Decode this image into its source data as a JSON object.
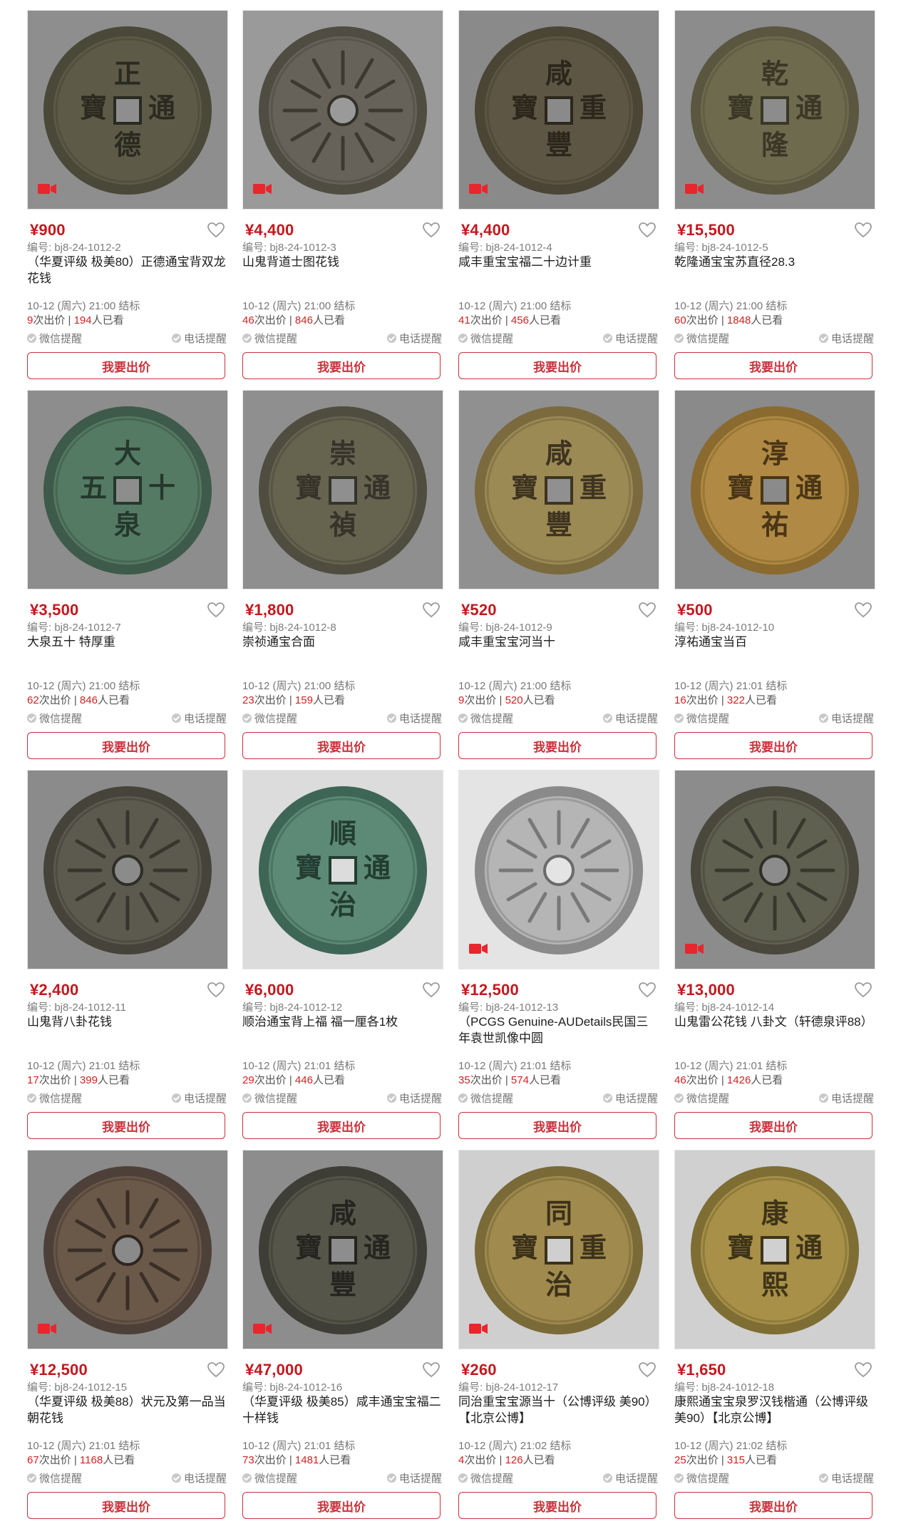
{
  "ui": {
    "code_prefix": "编号: ",
    "wechat_remind": "微信提醒",
    "phone_remind": "电话提醒",
    "bid_label": "我要出价",
    "bids_suffix": "次出价 | ",
    "viewers_suffix": "人已看",
    "currency": "¥",
    "video_icon": "video-camera-icon",
    "favorite_icon": "heart-outline-icon",
    "accent_color": "#c5171f"
  },
  "items": [
    {
      "price": "¥900",
      "code": "bj8-24-1012-2",
      "title": "（华夏评级 极美80）正德通宝背双龙花钱",
      "end": "10-12 (周六) 21:00 结标",
      "bids": "9",
      "views": "194",
      "coin": [
        "正",
        "通",
        "德",
        "寶"
      ],
      "video": true
    },
    {
      "price": "¥4,400",
      "code": "bj8-24-1012-3",
      "title": "山鬼背道士图花钱",
      "end": "10-12 (周六) 21:00 结标",
      "bids": "46",
      "views": "846",
      "coin": [
        "",
        "",
        "",
        ""
      ],
      "video": true
    },
    {
      "price": "¥4,400",
      "code": "bj8-24-1012-4",
      "title": "咸丰重宝宝福二十边计重",
      "end": "10-12 (周六) 21:00 结标",
      "bids": "41",
      "views": "456",
      "coin": [
        "咸",
        "重",
        "豐",
        "寶"
      ],
      "video": true
    },
    {
      "price": "¥15,500",
      "code": "bj8-24-1012-5",
      "title": "乾隆通宝宝苏直径28.3",
      "end": "10-12 (周六) 21:00 结标",
      "bids": "60",
      "views": "1848",
      "coin": [
        "乾",
        "通",
        "隆",
        "寶"
      ],
      "video": true
    },
    {
      "price": "¥3,500",
      "code": "bj8-24-1012-7",
      "title": "大泉五十 特厚重",
      "end": "10-12 (周六) 21:00 结标",
      "bids": "62",
      "views": "846",
      "coin": [
        "大",
        "十",
        "泉",
        "五"
      ],
      "video": false
    },
    {
      "price": "¥1,800",
      "code": "bj8-24-1012-8",
      "title": "崇祯通宝合面",
      "end": "10-12 (周六) 21:00 结标",
      "bids": "23",
      "views": "159",
      "coin": [
        "崇",
        "通",
        "禎",
        "寶"
      ],
      "video": false
    },
    {
      "price": "¥520",
      "code": "bj8-24-1012-9",
      "title": "咸丰重宝宝河当十",
      "end": "10-12 (周六) 21:00 结标",
      "bids": "9",
      "views": "520",
      "coin": [
        "咸",
        "重",
        "豐",
        "寶"
      ],
      "video": false
    },
    {
      "price": "¥500",
      "code": "bj8-24-1012-10",
      "title": "淳祐通宝当百",
      "end": "10-12 (周六) 21:01 结标",
      "bids": "16",
      "views": "322",
      "coin": [
        "淳",
        "通",
        "祐",
        "寶"
      ],
      "video": false
    },
    {
      "price": "¥2,400",
      "code": "bj8-24-1012-11",
      "title": "山鬼背八卦花钱",
      "end": "10-12 (周六) 21:01 结标",
      "bids": "17",
      "views": "399",
      "coin": [
        "",
        "",
        "",
        ""
      ],
      "video": false
    },
    {
      "price": "¥6,000",
      "code": "bj8-24-1012-12",
      "title": "顺治通宝背上福 福一厘各1枚",
      "end": "10-12 (周六) 21:01 结标",
      "bids": "29",
      "views": "446",
      "coin": [
        "順",
        "通",
        "治",
        "寶"
      ],
      "video": false
    },
    {
      "price": "¥12,500",
      "code": "bj8-24-1012-13",
      "title": "（PCGS Genuine-AUDetails民国三年袁世凯像中圆",
      "end": "10-12 (周六) 21:01 结标",
      "bids": "35",
      "views": "574",
      "coin": [
        "",
        "",
        "",
        ""
      ],
      "video": true
    },
    {
      "price": "¥13,000",
      "code": "bj8-24-1012-14",
      "title": "山鬼雷公花钱 八卦文（轩德泉评88）",
      "end": "10-12 (周六) 21:01 结标",
      "bids": "46",
      "views": "1426",
      "coin": [
        "",
        "",
        "",
        ""
      ],
      "video": true
    },
    {
      "price": "¥12,500",
      "code": "bj8-24-1012-15",
      "title": "（华夏评级 极美88）状元及第一品当朝花钱",
      "end": "10-12 (周六) 21:01 结标",
      "bids": "67",
      "views": "1168",
      "coin": [
        "",
        "",
        "",
        ""
      ],
      "video": true
    },
    {
      "price": "¥47,000",
      "code": "bj8-24-1012-16",
      "title": "（华夏评级 极美85）咸丰通宝宝福二十样钱",
      "end": "10-12 (周六) 21:01 结标",
      "bids": "73",
      "views": "1481",
      "coin": [
        "咸",
        "通",
        "豐",
        "寶"
      ],
      "video": true
    },
    {
      "price": "¥260",
      "code": "bj8-24-1012-17",
      "title": "同治重宝宝源当十（公博评级 美90）【北京公博】",
      "end": "10-12 (周六) 21:02 结标",
      "bids": "4",
      "views": "126",
      "coin": [
        "同",
        "重",
        "治",
        "寶"
      ],
      "video": true
    },
    {
      "price": "¥1,650",
      "code": "bj8-24-1012-18",
      "title": "康熙通宝宝泉罗汉钱楷通（公博评级 美90）【北京公博】",
      "end": "10-12 (周六) 21:02 结标",
      "bids": "25",
      "views": "315",
      "coin": [
        "康",
        "通",
        "熙",
        "寶"
      ],
      "video": false
    }
  ]
}
